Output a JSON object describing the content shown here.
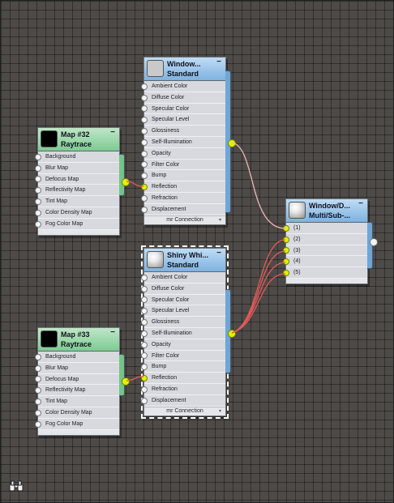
{
  "nodes": {
    "window_standard": {
      "title1": "Window...",
      "title2": "Standard",
      "minimize": "−",
      "slots": [
        "Ambient Color",
        "Diffuse Color",
        "Specular Color",
        "Specular Level",
        "Glossiness",
        "Self-Illumination",
        "Opacity",
        "Filter Color",
        "Bump",
        "Reflection",
        "Refraction",
        "Displacement"
      ],
      "footer": "mr Connection",
      "footer_arrow": "▾"
    },
    "shiny_standard": {
      "title1": "Shiny Whi...",
      "title2": "Standard",
      "minimize": "−",
      "slots": [
        "Ambient Color",
        "Diffuse Color",
        "Specular Color",
        "Specular Level",
        "Glossiness",
        "Self-Illumination",
        "Opacity",
        "Filter Color",
        "Bump",
        "Reflection",
        "Refraction",
        "Displacement"
      ],
      "footer": "mr Connection",
      "footer_arrow": "▾"
    },
    "map32": {
      "title1": "Map #32",
      "title2": "Raytrace",
      "minimize": "−",
      "slots": [
        "Background",
        "Blur Map",
        "Defocus Map",
        "Reflectivity Map",
        "Tint Map",
        "Color Density Map",
        "Fog Color Map"
      ]
    },
    "map33": {
      "title1": "Map #33",
      "title2": "Raytrace",
      "minimize": "−",
      "slots": [
        "Background",
        "Blur Map",
        "Defocus Map",
        "Reflectivity Map",
        "Tint Map",
        "Color Density Map",
        "Fog Color Map"
      ]
    },
    "multisub": {
      "title1": "Window/D...",
      "title2": "Multi/Sub-...",
      "minimize": "−",
      "slots": [
        "(1)",
        "(2)",
        "(3)",
        "(4)",
        "(5)"
      ]
    }
  },
  "colors": {
    "canvas_background": "#4d4a47",
    "wire": "#e35a5a",
    "socket_linked": "#dff200"
  }
}
